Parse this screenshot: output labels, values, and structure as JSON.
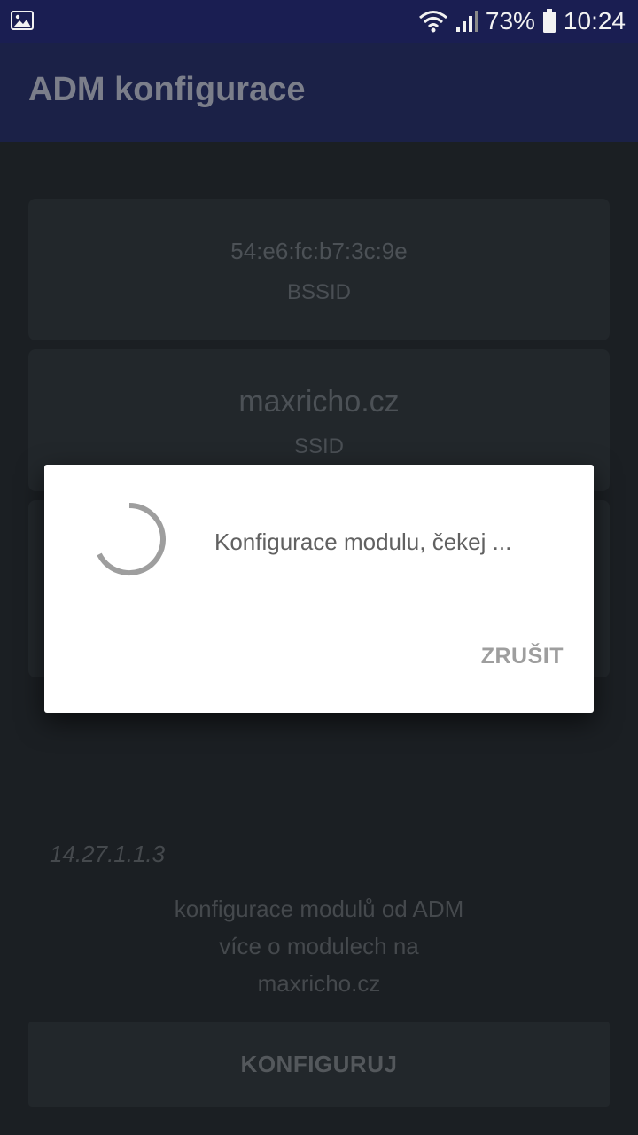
{
  "status_bar": {
    "battery_percent": "73%",
    "time": "10:24",
    "icons": [
      "image-icon",
      "wifi-icon",
      "signal-icon",
      "battery-icon"
    ]
  },
  "app_bar": {
    "title": "ADM konfigurace"
  },
  "cards": {
    "bssid": {
      "value": "54:e6:fc:b7:3c:9e",
      "label": "BSSID"
    },
    "ssid": {
      "value": "maxricho.cz",
      "label": "SSID"
    }
  },
  "footer": {
    "version": "14.27.1.1.3",
    "about_lines": [
      "konfigurace modulů od ADM",
      "více o modulech na",
      "maxricho.cz"
    ]
  },
  "configure_button": {
    "label": "KONFIGURUJ"
  },
  "dialog": {
    "message": "Konfigurace modulu, čekej ...",
    "cancel_label": "ZRUŠIT",
    "icon": "spinner-icon"
  },
  "colors": {
    "status_bar": "#1a1e52",
    "app_bar": "#1b2147",
    "background": "#1b1f23",
    "dialog": "#ffffff"
  }
}
